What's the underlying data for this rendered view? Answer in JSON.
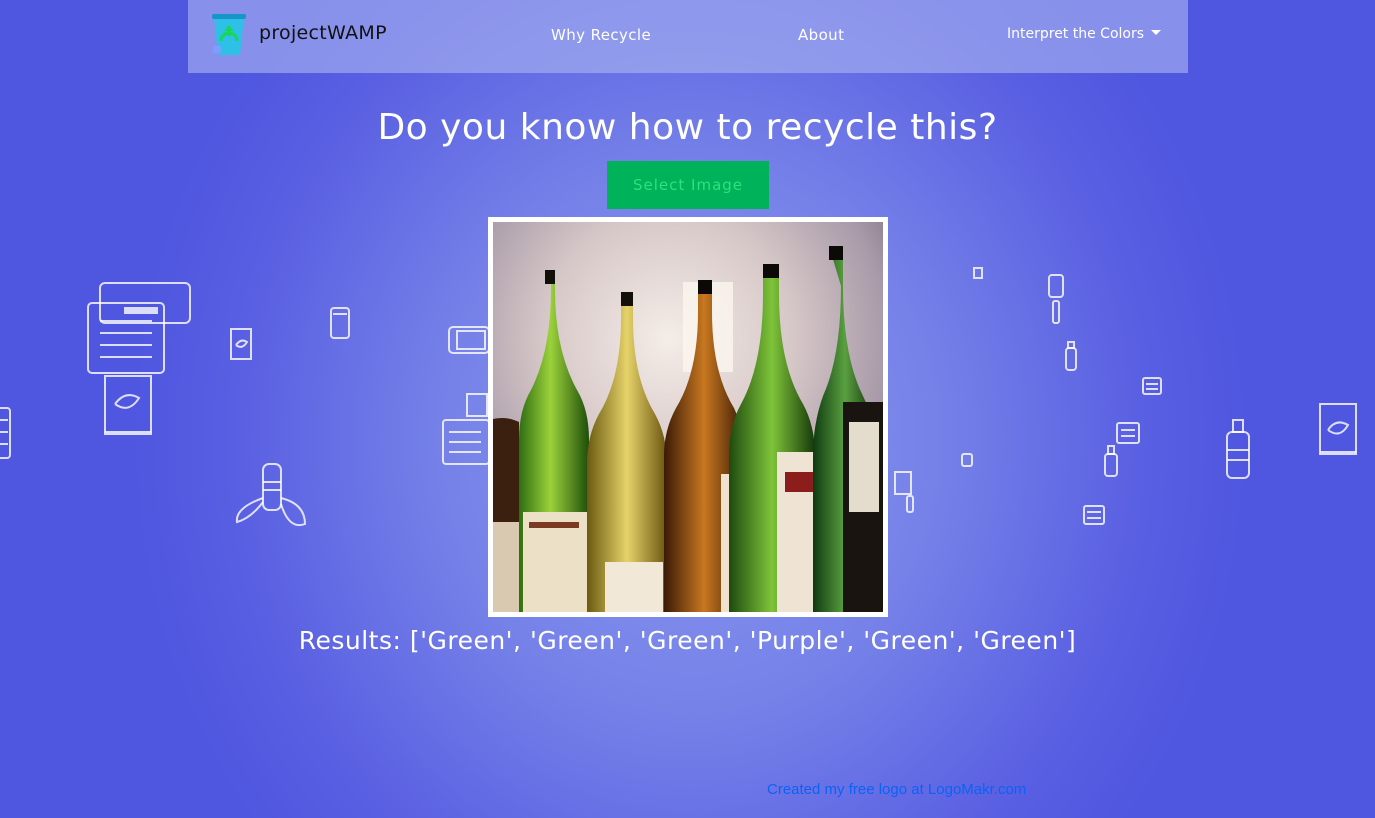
{
  "brand": {
    "name": "projectWAMP",
    "logo_icon": "recycle-bin-icon"
  },
  "nav": {
    "why_recycle": "Why Recycle",
    "about": "About",
    "interpret_colors": "Interpret the Colors"
  },
  "main": {
    "headline": "Do you know how to recycle this?",
    "select_button": "Select Image",
    "results": "Results: ['Green', 'Green', 'Green', 'Purple', 'Green', 'Green']"
  },
  "footer": {
    "credit_link": "Created my free logo at LogoMakr.com"
  },
  "colors": {
    "accent_green": "#00b35a",
    "link_blue": "#0b62f5",
    "background": "#5a60e2"
  },
  "background_icons": [
    "newspaper-icon",
    "chip-bag-icon",
    "soda-can-icon",
    "phone-icon",
    "banana-peel-icon",
    "water-bottle-icon"
  ]
}
